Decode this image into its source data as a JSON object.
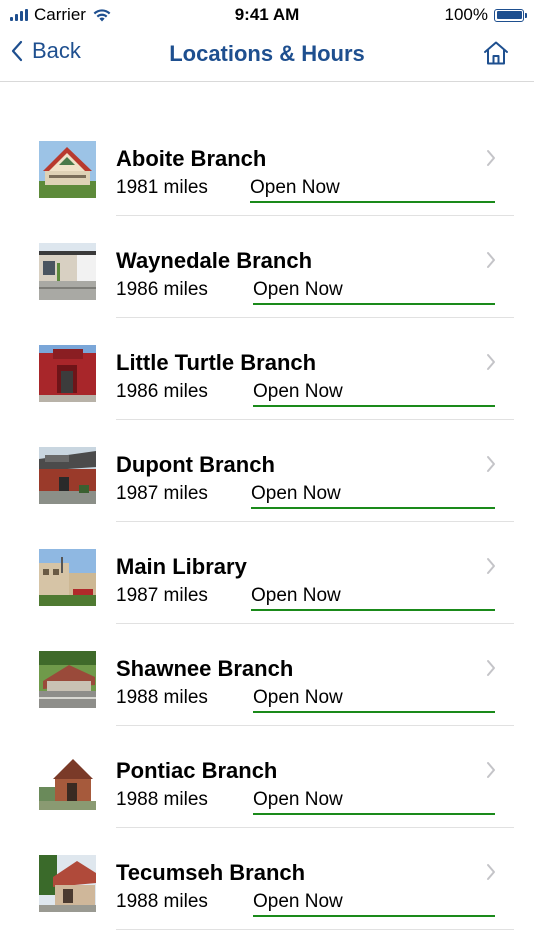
{
  "status_bar": {
    "carrier": "Carrier",
    "time": "9:41 AM",
    "battery": "100%"
  },
  "nav": {
    "back_label": "Back",
    "title": "Locations & Hours"
  },
  "colors": {
    "accent": "#1e4f8f",
    "open_underline": "#1a8a1a"
  },
  "locations": [
    {
      "name": "Aboite Branch",
      "distance": "1981 miles",
      "status": "Open Now"
    },
    {
      "name": "Waynedale Branch",
      "distance": "1986 miles",
      "status": "Open Now"
    },
    {
      "name": "Little Turtle Branch",
      "distance": "1986 miles",
      "status": "Open Now"
    },
    {
      "name": "Dupont Branch",
      "distance": "1987 miles",
      "status": "Open Now"
    },
    {
      "name": "Main Library",
      "distance": "1987 miles",
      "status": "Open Now"
    },
    {
      "name": "Shawnee Branch",
      "distance": "1988 miles",
      "status": "Open Now"
    },
    {
      "name": "Pontiac Branch",
      "distance": "1988 miles",
      "status": "Open Now"
    },
    {
      "name": "Tecumseh Branch",
      "distance": "1988 miles",
      "status": "Open Now"
    }
  ]
}
